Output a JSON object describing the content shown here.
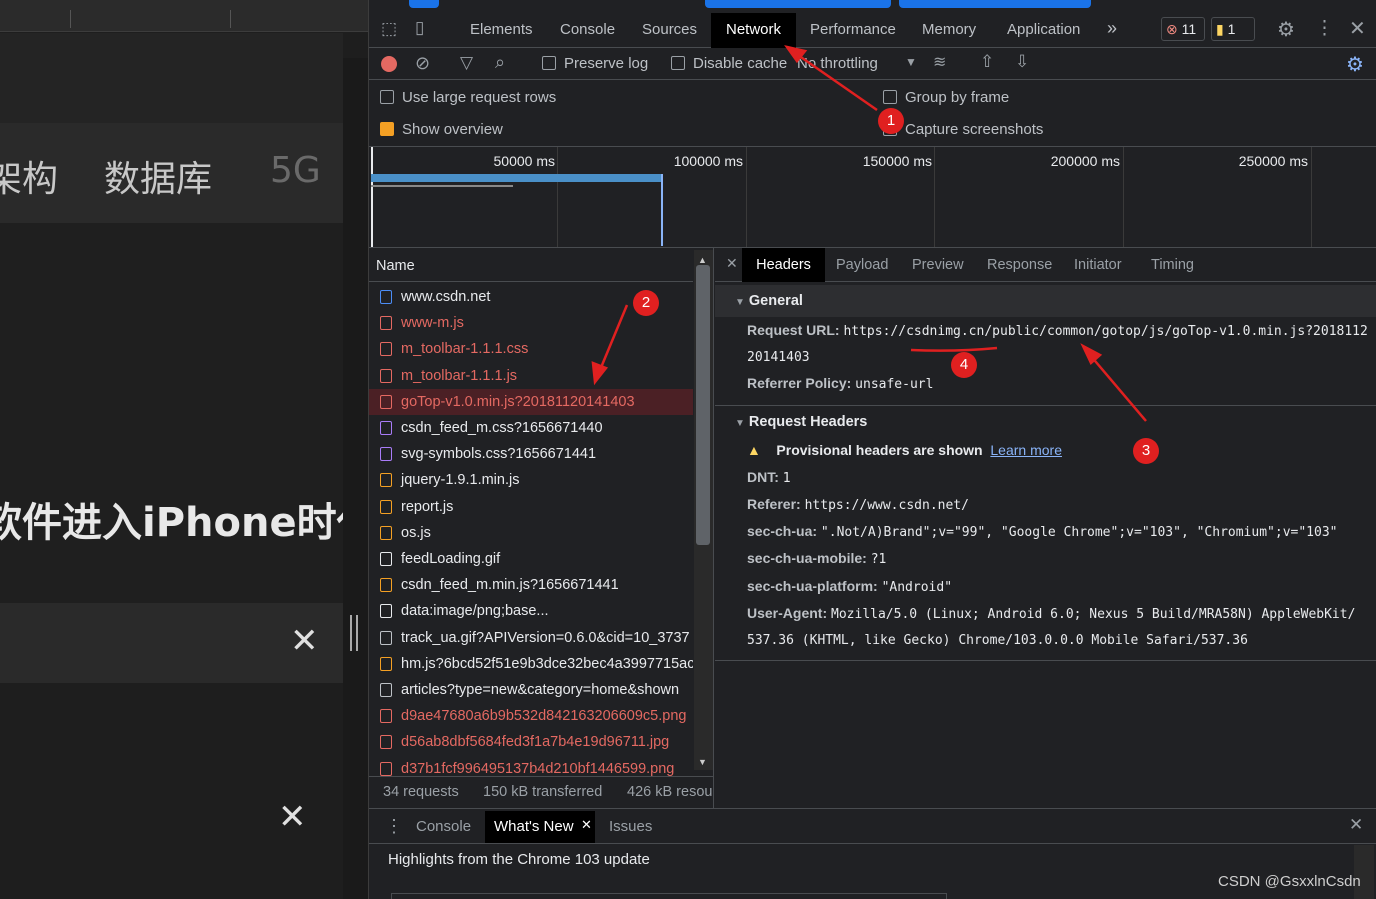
{
  "left_page": {
    "categories": [
      "架构",
      "数据库",
      "5G"
    ],
    "headline": "软件进入iPhone时代",
    "close_glyph": "✕"
  },
  "devtools": {
    "tabs": [
      "Elements",
      "Console",
      "Sources",
      "Network",
      "Performance",
      "Memory",
      "Application",
      "»"
    ],
    "active_tab": "Network",
    "error_count": "11",
    "warning_count": "1",
    "toolbar": {
      "preserve_log": "Preserve log",
      "disable_cache": "Disable cache",
      "throttling": "No throttling"
    },
    "options": {
      "large_rows": "Use large request rows",
      "show_overview": "Show overview",
      "group_by_frame": "Group by frame",
      "capture_screenshots": "Capture screenshots"
    },
    "timeline_ticks": [
      "50000 ms",
      "100000 ms",
      "150000 ms",
      "200000 ms",
      "250000 ms"
    ],
    "list_header": "Name",
    "requests": [
      {
        "name": "www.csdn.net",
        "color": "#e8eaed",
        "icon": "document-icon"
      },
      {
        "name": "www-m.js",
        "color": "#e46962",
        "icon": "script-icon"
      },
      {
        "name": "m_toolbar-1.1.1.css",
        "color": "#e46962",
        "icon": "stylesheet-icon"
      },
      {
        "name": "m_toolbar-1.1.1.js",
        "color": "#e46962",
        "icon": "script-icon"
      },
      {
        "name": "goTop-v1.0.min.js?20181120141403",
        "color": "#e46962",
        "icon": "script-icon"
      },
      {
        "name": "csdn_feed_m.css?1656671440",
        "color": "#e8eaed",
        "icon": "stylesheet-icon"
      },
      {
        "name": "svg-symbols.css?1656671441",
        "color": "#e8eaed",
        "icon": "stylesheet-icon"
      },
      {
        "name": "jquery-1.9.1.min.js",
        "color": "#e8eaed",
        "icon": "script-icon"
      },
      {
        "name": "report.js",
        "color": "#e8eaed",
        "icon": "script-icon"
      },
      {
        "name": "os.js",
        "color": "#e8eaed",
        "icon": "script-icon"
      },
      {
        "name": "feedLoading.gif",
        "color": "#e8eaed",
        "icon": "image-icon"
      },
      {
        "name": "csdn_feed_m.min.js?1656671441",
        "color": "#e8eaed",
        "icon": "script-icon"
      },
      {
        "name": "data:image/png;base...",
        "color": "#e8eaed",
        "icon": "image-icon"
      },
      {
        "name": "track_ua.gif?APIVersion=0.6.0&cid=10_3737",
        "color": "#e8eaed",
        "icon": "other-icon"
      },
      {
        "name": "hm.js?6bcd52f51e9b3dce32bec4a3997715ac",
        "color": "#e8eaed",
        "icon": "script-icon"
      },
      {
        "name": "articles?type=new&category=home&shown",
        "color": "#e8eaed",
        "icon": "other-icon"
      },
      {
        "name": "d9ae47680a6b9b532d842163206609c5.png",
        "color": "#e46962",
        "icon": "image-icon"
      },
      {
        "name": "d56ab8dbf5684fed3f1a7b4e19d96711.jpg",
        "color": "#e46962",
        "icon": "image-icon"
      },
      {
        "name": "d37b1fcf996495137b4d210bf1446599.png",
        "color": "#e46962",
        "icon": "image-icon"
      }
    ],
    "footer": {
      "requests": "34 requests",
      "transferred": "150 kB transferred",
      "resources": "426 kB resou"
    },
    "detail_tabs": [
      "Headers",
      "Payload",
      "Preview",
      "Response",
      "Initiator",
      "Timing"
    ],
    "general": {
      "title": "General",
      "request_url_key": "Request URL:",
      "request_url_val": "https://csdnimg.cn/public/common/gotop/js/goTop-v1.0.min.js?2018112",
      "request_url_cont": "20141403",
      "referrer_policy_key": "Referrer Policy:",
      "referrer_policy_val": "unsafe-url"
    },
    "request_headers": {
      "title": "Request Headers",
      "provisional": "Provisional headers are shown",
      "learn_more": "Learn more",
      "dnt_key": "DNT:",
      "dnt_val": "1",
      "referer_key": "Referer:",
      "referer_val": "https://www.csdn.net/",
      "secua_key": "sec-ch-ua:",
      "secua_val": "\".Not/A)Brand\";v=\"99\", \"Google Chrome\";v=\"103\", \"Chromium\";v=\"103\"",
      "mobile_key": "sec-ch-ua-mobile:",
      "mobile_val": "?1",
      "platform_key": "sec-ch-ua-platform:",
      "platform_val": "\"Android\"",
      "ua_key": "User-Agent:",
      "ua_val": "Mozilla/5.0 (Linux; Android 6.0; Nexus 5 Build/MRA58N) AppleWebKit/",
      "ua_cont": "537.36 (KHTML, like Gecko) Chrome/103.0.0.0 Mobile Safari/537.36"
    },
    "drawer": {
      "tabs": [
        "Console",
        "What's New",
        "Issues"
      ],
      "message": "Highlights from the Chrome 103 update"
    }
  },
  "annotations": [
    "1",
    "2",
    "3",
    "4"
  ],
  "watermark": "CSDN @GsxxlnCsdn"
}
